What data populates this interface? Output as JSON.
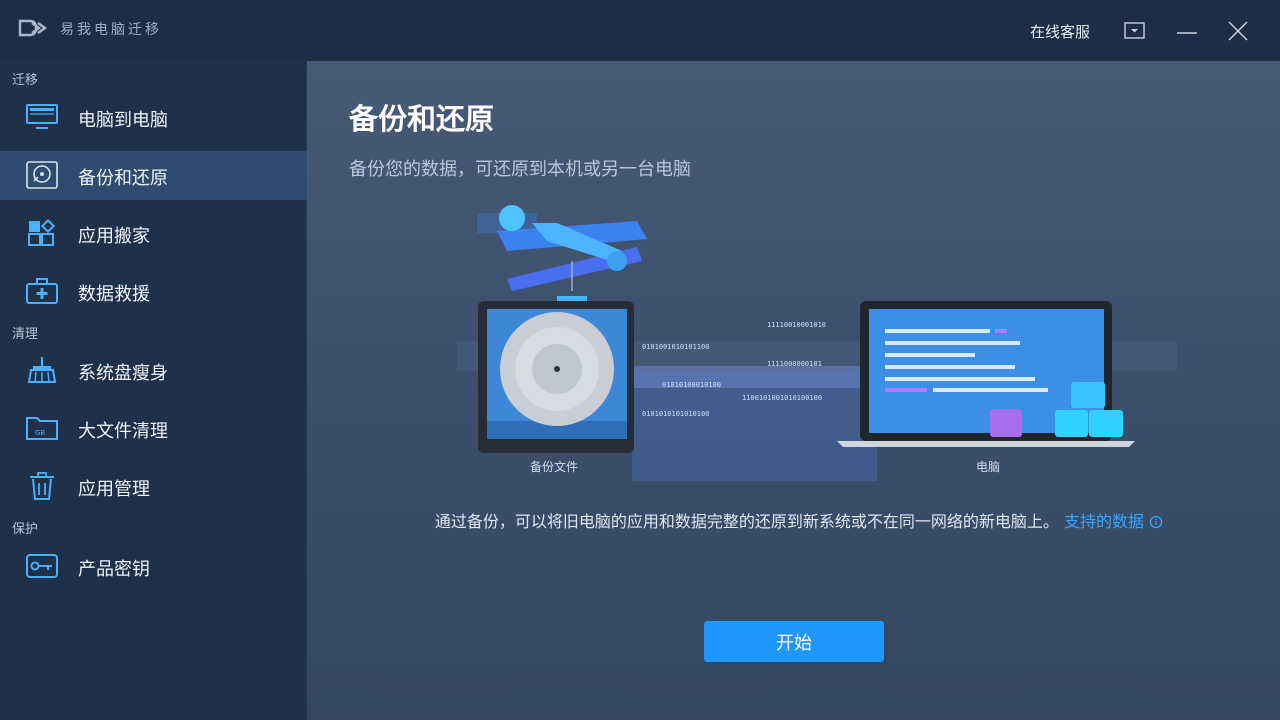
{
  "app": {
    "title": "易我电脑迁移",
    "support_label": "在线客服"
  },
  "sidebar": {
    "sections": [
      {
        "label": "迁移"
      },
      {
        "label": "清理"
      },
      {
        "label": "保护"
      }
    ],
    "items": [
      {
        "label": "电脑到电脑",
        "icon": "monitor-icon"
      },
      {
        "label": "备份和还原",
        "icon": "backup-disc-icon",
        "active": true
      },
      {
        "label": "应用搬家",
        "icon": "apps-grid-icon"
      },
      {
        "label": "数据救援",
        "icon": "first-aid-kit-icon"
      },
      {
        "label": "系统盘瘦身",
        "icon": "broom-icon"
      },
      {
        "label": "大文件清理",
        "icon": "folder-gb-icon"
      },
      {
        "label": "应用管理",
        "icon": "trash-icon"
      },
      {
        "label": "产品密钥",
        "icon": "key-icon"
      }
    ]
  },
  "main": {
    "title": "备份和还原",
    "subtitle": "备份您的数据，可还原到本机或另一台电脑",
    "illustration": {
      "left_caption": "备份文件",
      "right_caption": "电脑",
      "binary_lines": [
        "11110010001010",
        "0101001010101100",
        "1111000000101",
        "01010100010100",
        "1100101001010100100",
        "0101010101010100"
      ]
    },
    "description": "通过备份，可以将旧电脑的应用和数据完整的还原到新系统或不在同一网络的新电脑上。",
    "link_label": "支持的数据",
    "link_icon": "info-icon",
    "start_button": "开始"
  },
  "colors": {
    "accent": "#1e98ff",
    "link": "#3aa6ff",
    "sidebar_bg": "#1f3049",
    "active_bg": "#2f4c70"
  }
}
